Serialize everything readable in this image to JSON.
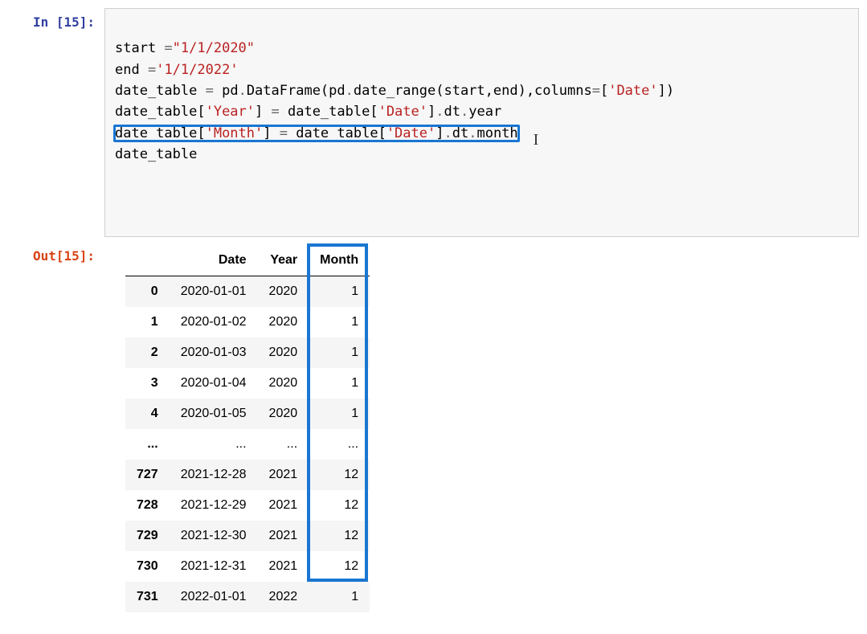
{
  "prompt": {
    "in": "In [15]:",
    "out": "Out[15]:"
  },
  "code": {
    "l1a": "start ",
    "l1b": "=",
    "l1c": "\"1/1/2020\"",
    "l2a": "end ",
    "l2b": "=",
    "l2c": "'1/1/2022'",
    "l3a": "date_table ",
    "l3b": "=",
    "l3c": " pd",
    "l3d": ".",
    "l3e": "DataFrame(pd",
    "l3f": ".",
    "l3g": "date_range(start,end),columns",
    "l3h": "=",
    "l3i": "[",
    "l3j": "'Date'",
    "l3k": "])",
    "l4a": "date_table[",
    "l4b": "'Year'",
    "l4c": "] ",
    "l4d": "=",
    "l4e": " date_table[",
    "l4f": "'Date'",
    "l4g": "]",
    "l4h": ".",
    "l4i": "dt",
    "l4j": ".",
    "l4k": "year",
    "l5a": "date_table[",
    "l5b": "'Month'",
    "l5c": "] ",
    "l5d": "=",
    "l5e": " date_table[",
    "l5f": "'Date'",
    "l5g": "]",
    "l5h": ".",
    "l5i": "dt",
    "l5j": ".",
    "l5k": "month",
    "l6a": "date_table"
  },
  "table": {
    "cols": {
      "blank": "",
      "date": "Date",
      "year": "Year",
      "month": "Month"
    },
    "rows": [
      {
        "idx": "0",
        "date": "2020-01-01",
        "year": "2020",
        "month": "1"
      },
      {
        "idx": "1",
        "date": "2020-01-02",
        "year": "2020",
        "month": "1"
      },
      {
        "idx": "2",
        "date": "2020-01-03",
        "year": "2020",
        "month": "1"
      },
      {
        "idx": "3",
        "date": "2020-01-04",
        "year": "2020",
        "month": "1"
      },
      {
        "idx": "4",
        "date": "2020-01-05",
        "year": "2020",
        "month": "1"
      },
      {
        "idx": "...",
        "date": "...",
        "year": "...",
        "month": "..."
      },
      {
        "idx": "727",
        "date": "2021-12-28",
        "year": "2021",
        "month": "12"
      },
      {
        "idx": "728",
        "date": "2021-12-29",
        "year": "2021",
        "month": "12"
      },
      {
        "idx": "729",
        "date": "2021-12-30",
        "year": "2021",
        "month": "12"
      },
      {
        "idx": "730",
        "date": "2021-12-31",
        "year": "2021",
        "month": "12"
      },
      {
        "idx": "731",
        "date": "2022-01-01",
        "year": "2022",
        "month": "1"
      }
    ]
  },
  "highlight": {
    "code_line": 5,
    "column": "Month"
  }
}
